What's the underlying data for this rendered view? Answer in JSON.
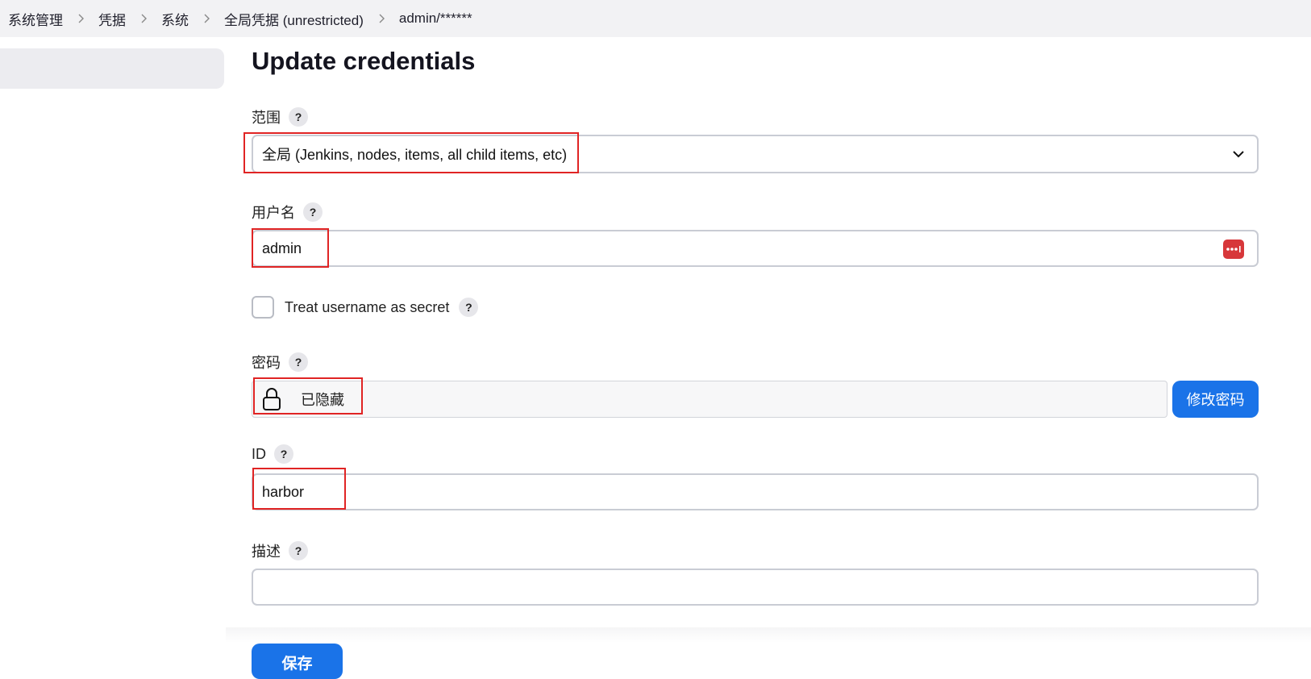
{
  "breadcrumb": [
    "系统管理",
    "凭据",
    "系统",
    "全局凭据 (unrestricted)",
    "admin/******"
  ],
  "page": {
    "title": "Update credentials"
  },
  "form": {
    "scope": {
      "label": "范围",
      "help": "?",
      "value": "全局 (Jenkins, nodes, items, all child items, etc)",
      "icon": "chevron-down-icon"
    },
    "username": {
      "label": "用户名",
      "help": "?",
      "value": "admin",
      "icon": "password-manager-icon"
    },
    "treat_username_secret": {
      "label": "Treat username as secret",
      "help": "?",
      "checked": false
    },
    "password": {
      "label": "密码",
      "help": "?",
      "hidden_text": "已隐藏",
      "icon": "lock-icon",
      "change_button": "修改密码"
    },
    "id": {
      "label": "ID",
      "help": "?",
      "value": "harbor"
    },
    "description": {
      "label": "描述",
      "help": "?",
      "value": ""
    }
  },
  "actions": {
    "save": "保存"
  },
  "colors": {
    "primary": "#1a73e8",
    "highlight": "#e02424",
    "password_manager": "#d7373a"
  }
}
